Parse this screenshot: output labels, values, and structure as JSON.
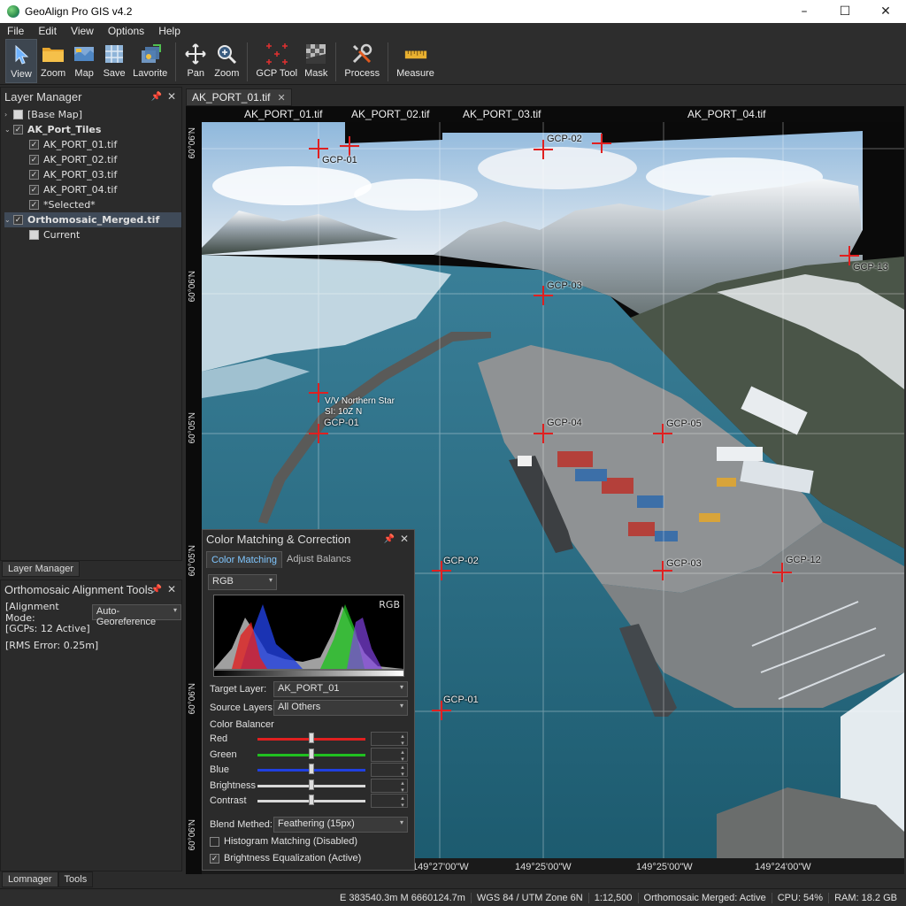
{
  "window": {
    "title": "GeoAlign Pro GIS v4.2",
    "controls": [
      "–",
      "☐",
      "✕"
    ]
  },
  "menu": [
    "File",
    "Edit",
    "View",
    "Options",
    "Help"
  ],
  "toolbar": {
    "buttons": [
      {
        "label": "View",
        "icon": "cursor-arrow-icon"
      },
      {
        "label": "Zoom",
        "icon": "folder-icon"
      },
      {
        "label": "Map",
        "icon": "map-icon"
      },
      {
        "label": "Save",
        "icon": "grid-save-icon"
      },
      {
        "label": "Lavorite",
        "icon": "favorite-layers-icon"
      },
      {
        "label": "Pan",
        "icon": "pan-arrows-icon"
      },
      {
        "label": "Zoom",
        "icon": "magnifier-icon"
      },
      {
        "label": "GCP Tool",
        "icon": "gcp-crosshair-icon"
      },
      {
        "label": "Mask",
        "icon": "mask-icon"
      },
      {
        "label": "Process",
        "icon": "tools-icon"
      },
      {
        "label": "Measure",
        "icon": "ruler-icon"
      }
    ]
  },
  "layer_manager": {
    "title": "Layer Manager",
    "items": [
      {
        "label": "[Base Map]",
        "checked": false
      },
      {
        "label": "AK_Port_Tiles",
        "checked": true,
        "bold": true
      },
      {
        "label": "AK_PORT_01.tif",
        "checked": true
      },
      {
        "label": "AK_PORT_02.tif",
        "checked": true
      },
      {
        "label": "AK_PORT_03.tif",
        "checked": true
      },
      {
        "label": "AK_PORT_04.tif",
        "checked": true
      },
      {
        "label": "*Selected*",
        "checked": true
      },
      {
        "label": "Orthomosaic_Merged.tif",
        "checked": true,
        "bold": true,
        "selected": true
      },
      {
        "label": "Current",
        "checked": false
      }
    ],
    "tab": "Layer Manager"
  },
  "alignment_tools": {
    "title": "Orthomosaic Alignment Tools",
    "mode_label": "[Alignment Mode:",
    "mode_value": "Auto-Georeference",
    "gcps": "[GCPs: 12 Active]",
    "rms": "[RMS Error: 0.25m]",
    "tabs": [
      "Lomnager",
      "Tools"
    ]
  },
  "document": {
    "tab": "AK_PORT_01.tif",
    "tile_labels": [
      "AK_PORT_01.tif",
      "AK_PORT_02.tif",
      "AK_PORT_03.tif",
      "AK_PORT_04.tif"
    ],
    "lat_labels": [
      "60°06'N",
      "60°06'N",
      "60°05'N",
      "60°05'N",
      "60°06'N",
      "60°06'N"
    ],
    "lon_labels": [
      "149°27'00\"W",
      "149°27'00\"W",
      "149°25'00\"W",
      "149°25'00\"W",
      "149°24'00\"W"
    ],
    "gcp_labels": [
      "GCP-01",
      "GCP-02",
      "GCP-03",
      "GCP-13",
      "GCP-01",
      "GCP-04",
      "GCP-05",
      "GCP-02",
      "GCP-03",
      "GCP-12",
      "GCP-01"
    ],
    "vessel_name": "V/V Northern Star",
    "vessel_coord": "SI: 10Z N"
  },
  "color_matching": {
    "title": "Color Matching & Correction",
    "tabs": [
      "Color Matching",
      "Adjust Balancs"
    ],
    "channel": "RGB",
    "histogram_label": "RGB",
    "target_layer_label": "Target Layer:",
    "target_layer_value": "AK_PORT_01",
    "source_layers_label": "Source Layers:",
    "source_layers_value": "All Others",
    "balancer_label": "Color Balancer",
    "sliders": [
      {
        "label": "Red",
        "color": "#e02020",
        "level": 0.5
      },
      {
        "label": "Green",
        "color": "#20c020",
        "level": 0.5
      },
      {
        "label": "Blue",
        "color": "#2040e0",
        "level": 0.5
      },
      {
        "label": "Brightness",
        "color": "#d8d8d8",
        "level": 0.5
      },
      {
        "label": "Contrast",
        "color": "#d8d8d8",
        "level": 0.5
      }
    ],
    "blend_label": "Blend Methed:",
    "blend_value": "Feathering (15px)",
    "histogram_matching": "Histogram Matching (Disabled)",
    "brightness_equalization": "Brightness Equalization (Active)"
  },
  "status": {
    "coords": "E 383540.3m  M 6660124.7m",
    "crs": "WGS 84 / UTM Zone 6N",
    "scale": "1:12,500",
    "layer": "Orthomosaic Merged: Active",
    "cpu": "CPU: 54%",
    "ram": "RAM: 18.2 GB"
  }
}
